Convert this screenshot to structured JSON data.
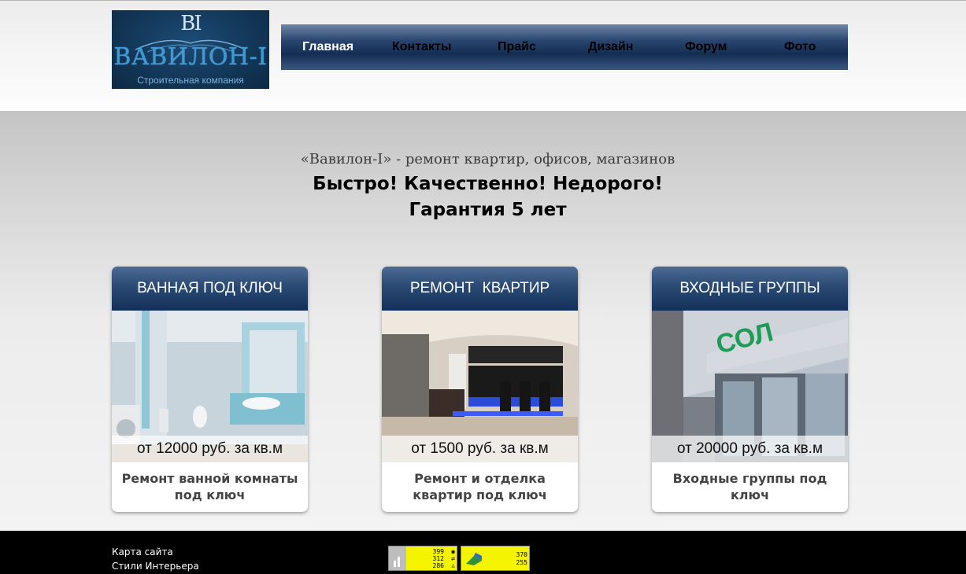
{
  "logo": {
    "monogram": "BI",
    "title": "ВАВИЛОН-I",
    "subtitle": "Строительная компания"
  },
  "nav": {
    "items": [
      {
        "label": "Главная",
        "active": true
      },
      {
        "label": "Контакты",
        "active": false
      },
      {
        "label": "Прайс",
        "active": false
      },
      {
        "label": "Дизайн",
        "active": false
      },
      {
        "label": "Форум",
        "active": false
      },
      {
        "label": "Фото",
        "active": false
      }
    ]
  },
  "hero": {
    "tagline": "«Вавилон-I» - ремонт квартир, офисов, магазинов",
    "headline_1": "Быстро! Качественно! Недорого!",
    "headline_2": "Гарантия 5 лет"
  },
  "cards": [
    {
      "title": "ВАННАЯ ПОД КЛЮЧ",
      "price": "от 12000 руб. за кв.м",
      "description": "Ремонт ванной комнаты под ключ"
    },
    {
      "title": "РЕМОНТ  КВАРТИР",
      "price": "от 1500 руб. за кв.м",
      "description": "Ремонт и отделка квартир под ключ"
    },
    {
      "title": "ВХОДНЫЕ ГРУППЫ",
      "price": "от 20000 руб. за кв.м",
      "description": "Входные группы под ключ"
    }
  ],
  "footer": {
    "links": [
      "Карта сайта",
      "Стили Интерьера"
    ],
    "counter_1": {
      "values": [
        "399",
        "312",
        "286"
      ]
    },
    "counter_2": {
      "values": [
        "370",
        "255"
      ]
    }
  },
  "colors": {
    "nav_bg": "#1f3a63",
    "card_header": "#24446e",
    "footer_bg": "#000000",
    "counter_bg": "#f4f400"
  }
}
